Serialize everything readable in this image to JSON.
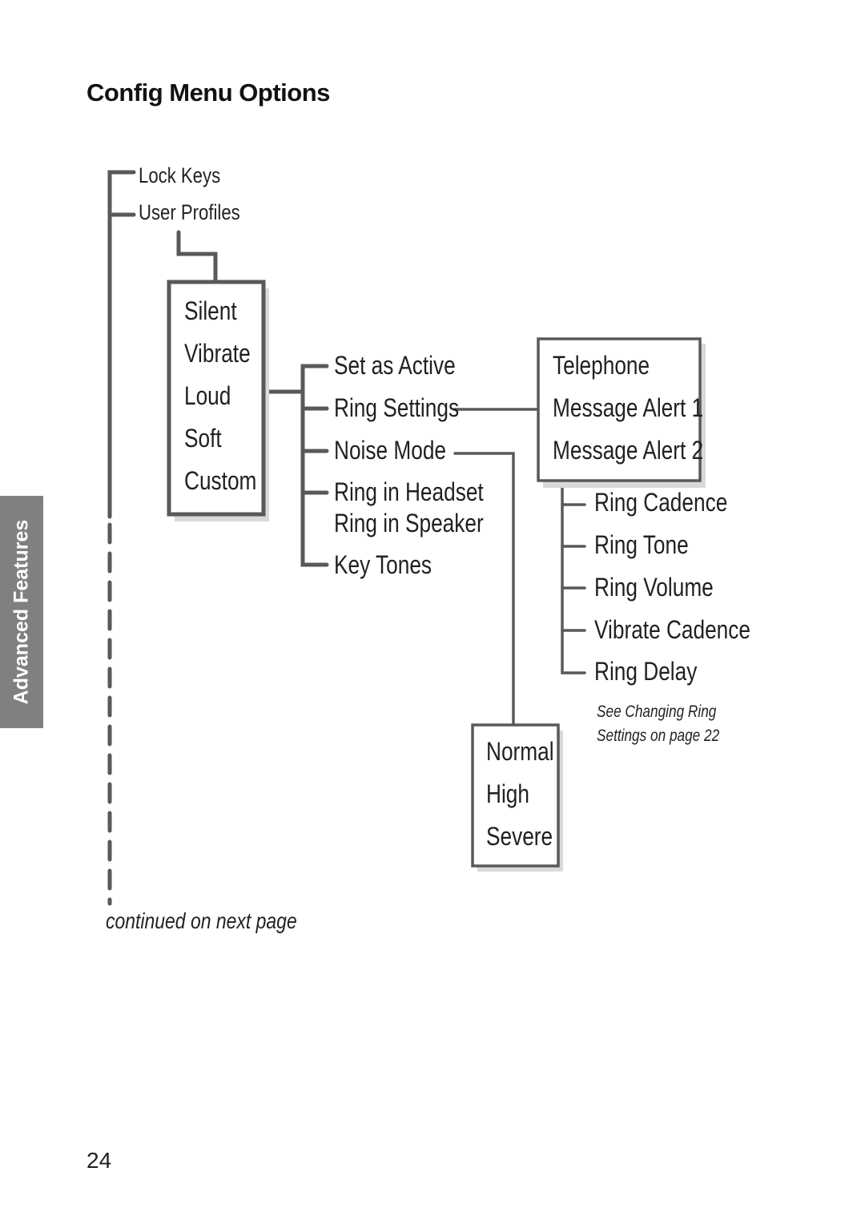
{
  "page": {
    "title": "Config Menu Options",
    "side_tab": "Advanced Features",
    "page_number": "24",
    "continued_note": "continued on next page"
  },
  "colors": {
    "line": "#595959",
    "side_tab_bg": "#808080",
    "box_shadow": "#d9d9d9",
    "text": "#231f20"
  },
  "tree": {
    "root_items": [
      "Lock Keys",
      "User Profiles"
    ],
    "profiles": [
      "Silent",
      "Vibrate",
      "Loud",
      "Soft",
      "Custom"
    ],
    "profile_options": [
      "Set as Active",
      "Ring Settings",
      "Noise Mode",
      "Ring in Headset",
      "Ring in Speaker",
      "Key Tones"
    ],
    "ring_types": [
      "Telephone",
      "Message Alert 1",
      "Message Alert 2"
    ],
    "ring_settings": [
      "Ring Cadence",
      "Ring Tone",
      "Ring Volume",
      "Vibrate Cadence",
      "Ring Delay"
    ],
    "ring_settings_note": [
      "See Changing Ring",
      "Settings on page 22"
    ],
    "noise_modes": [
      "Normal",
      "High",
      "Severe"
    ]
  }
}
